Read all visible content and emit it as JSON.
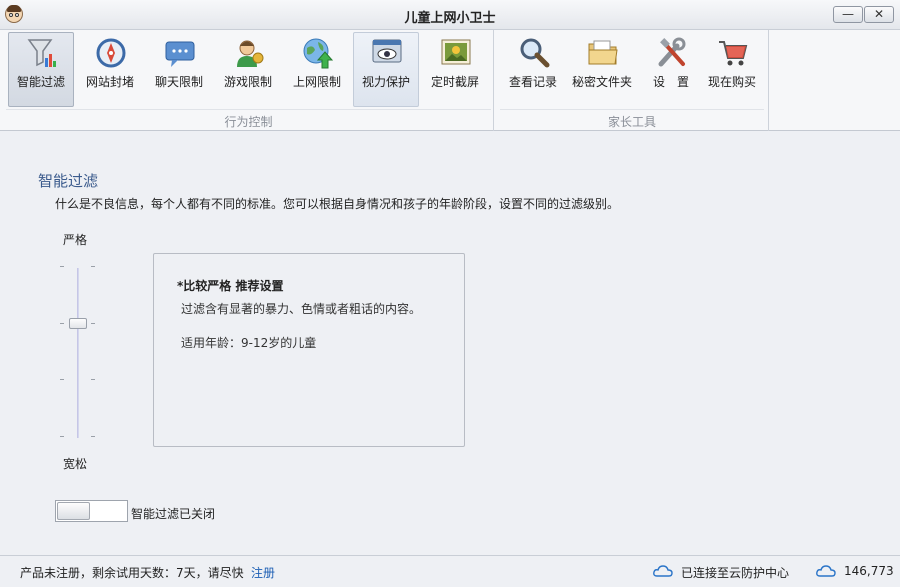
{
  "window": {
    "title": "儿童上网小卫士",
    "minimize_label": "—",
    "close_label": "✕"
  },
  "toolbar": {
    "groups": [
      {
        "label": "行为控制"
      },
      {
        "label": "家长工具"
      }
    ],
    "tools": [
      {
        "label": "智能过滤",
        "icon": "filter-funnel-icon"
      },
      {
        "label": "网站封堵",
        "icon": "compass-icon"
      },
      {
        "label": "聊天限制",
        "icon": "chat-bubble-icon"
      },
      {
        "label": "游戏限制",
        "icon": "game-character-icon"
      },
      {
        "label": "上网限制",
        "icon": "globe-arrow-icon"
      },
      {
        "label": "视力保护",
        "icon": "eye-monitor-icon"
      },
      {
        "label": "定时截屏",
        "icon": "screenshot-icon"
      },
      {
        "label": "查看记录",
        "icon": "magnifier-icon"
      },
      {
        "label": "秘密文件夹",
        "icon": "folder-icon"
      },
      {
        "label": "设　置",
        "icon": "tools-wrench-icon"
      },
      {
        "label": "现在购买",
        "icon": "shopping-cart-icon"
      }
    ]
  },
  "main": {
    "title": "智能过滤",
    "description": "什么是不良信息，每个人都有不同的标准。您可以根据自身情况和孩子的年龄阶段，设置不同的过滤级别。",
    "slider": {
      "top_label": "严格",
      "bottom_label": "宽松",
      "level_index": 1,
      "level_count": 4
    },
    "level_info": {
      "title": "*比较严格 推荐设置",
      "line1": "过滤含有显著的暴力、色情或者粗话的内容。",
      "line2": "适用年龄：9-12岁的儿童"
    },
    "toggle": {
      "state": "off",
      "label": "智能过滤已关闭"
    }
  },
  "status": {
    "registration_text": "产品未注册，剩余试用天数：7天，请尽快",
    "register_link": "注册",
    "connection_text": "已连接至云防护中心",
    "count": "146,773"
  },
  "colors": {
    "accent": "#3a5a8c",
    "link": "#1d5fb4",
    "cloud": "#2a74c8"
  }
}
